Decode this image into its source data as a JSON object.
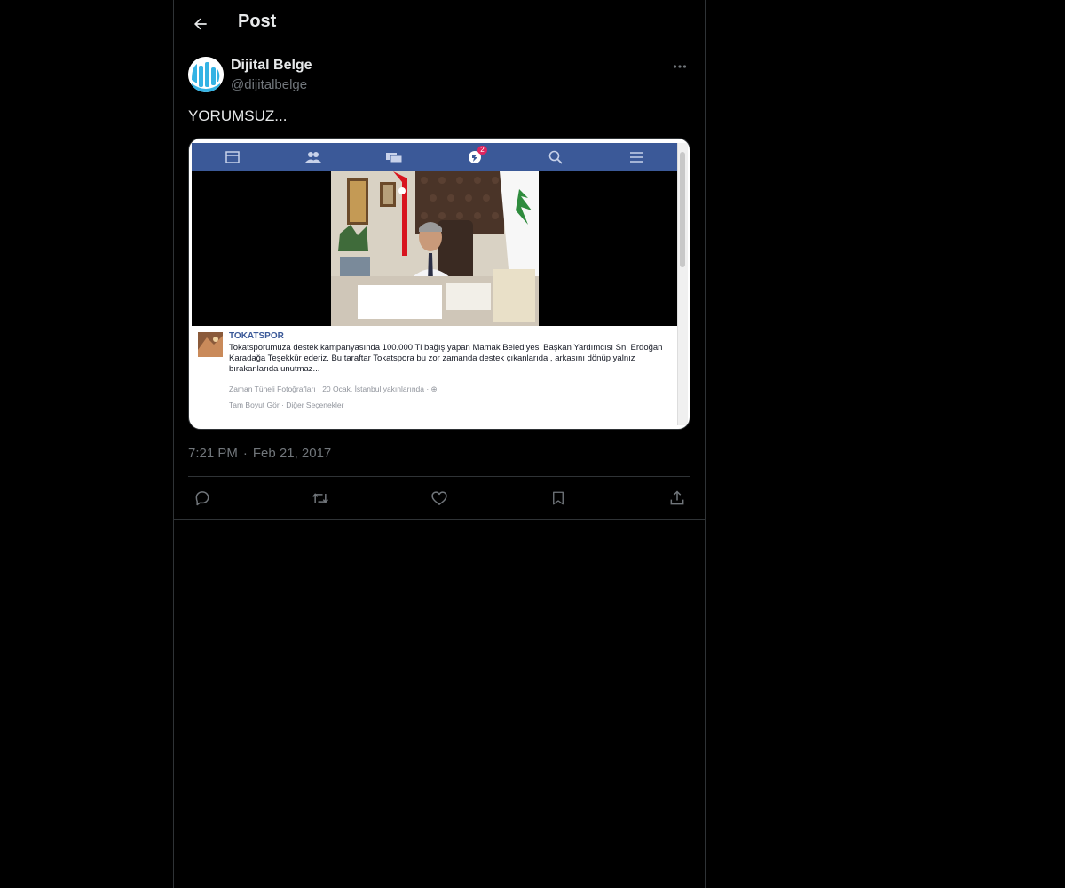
{
  "header": {
    "title": "Post",
    "back_icon": "arrow-left-icon"
  },
  "post": {
    "author_name": "Dijital Belge",
    "author_handle": "@dijitalbelge",
    "text": "YORUMSUZ...",
    "time": "7:21 PM",
    "separator": "·",
    "date": "Feb 21, 2017",
    "media": {
      "notification_count": "2",
      "page_name": "TOKATSPOR",
      "caption": "Tokatsporumuza destek kampanyasında 100.000 Tl bağış yapan Mamak Belediyesi Başkan Yardımcısı Sn. Erdoğan Karadağa Teşekkür ederiz. Bu taraftar Tokatspora bu zor zamanda destek çıkanlarıda , arkasını dönüp yalnız bırakanlarıda unutmaz...",
      "meta": "Zaman Tüneli Fotoğrafları · 20 Ocak, İstanbul yakınlarında · ⊕",
      "actions": "Tam Boyut Gör · Diğer Seçenekler"
    }
  },
  "actions": {
    "icons": [
      "reply-icon",
      "repost-icon",
      "like-icon",
      "bookmark-icon",
      "share-icon"
    ]
  },
  "colors": {
    "background": "#000000",
    "text_primary": "#e7e9ea",
    "text_secondary": "#71767b",
    "border": "#2f3336",
    "facebook_blue": "#3b5998"
  }
}
